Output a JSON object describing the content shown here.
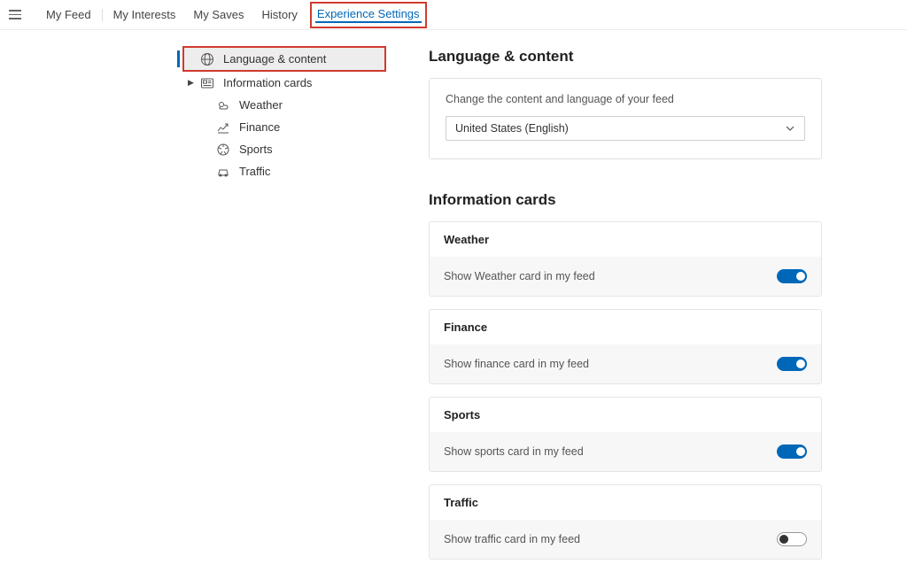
{
  "topnav": {
    "items": [
      "My Feed",
      "My Interests",
      "My Saves",
      "History"
    ],
    "active": "Experience Settings"
  },
  "sidebar": {
    "active": "Language & content",
    "items": [
      {
        "label": "Information cards",
        "expandable": true
      },
      {
        "label": "Weather"
      },
      {
        "label": "Finance"
      },
      {
        "label": "Sports"
      },
      {
        "label": "Traffic"
      }
    ]
  },
  "language_section": {
    "title": "Language & content",
    "desc": "Change the content and language of your feed",
    "selected": "United States (English)"
  },
  "info_section": {
    "title": "Information cards",
    "cards": [
      {
        "title": "Weather",
        "desc": "Show Weather card in my feed",
        "on": true
      },
      {
        "title": "Finance",
        "desc": "Show finance card in my feed",
        "on": true
      },
      {
        "title": "Sports",
        "desc": "Show sports card in my feed",
        "on": true
      },
      {
        "title": "Traffic",
        "desc": "Show traffic card in my feed",
        "on": false
      }
    ]
  }
}
